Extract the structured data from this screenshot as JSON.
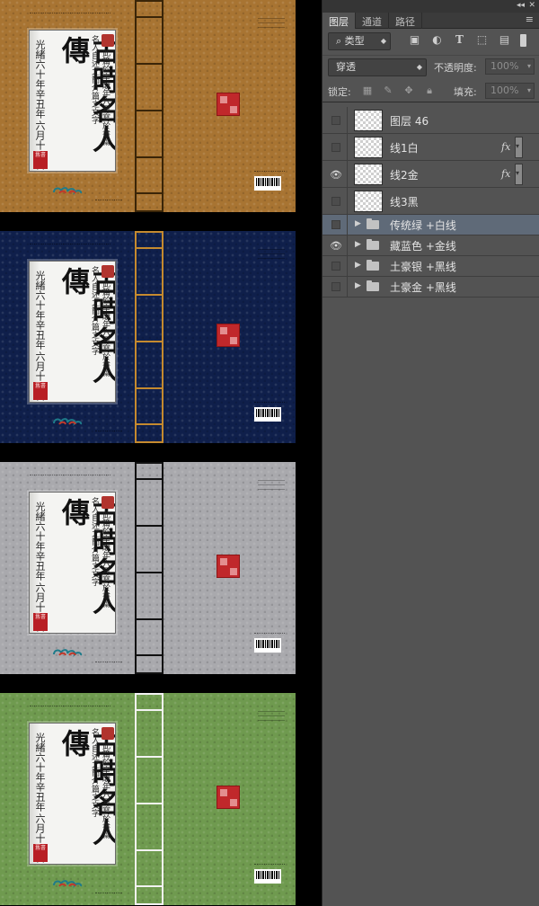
{
  "covers": [
    {
      "id": "brown",
      "bg": "#a87432",
      "spine_line": "#3a2508",
      "title": "古時名人傳",
      "date": "光緒六十年辛丑年",
      "date2": "六月十八日",
      "desc1": "名人自述之簡介篇之文字",
      "desc2": "此篇於辛醜年六月寫於書齋",
      "seal_text": "舊書"
    },
    {
      "id": "navy",
      "bg": "#0f1f4b",
      "spine_line": "#c58a2f",
      "title": "古時名人傳",
      "date": "光緒六十年辛丑年",
      "date2": "六月十八日",
      "desc1": "名人自述之簡介篇之文字",
      "desc2": "此篇於辛醜年六月寫於書齋",
      "seal_text": "舊書"
    },
    {
      "id": "silver",
      "bg": "#a9a9ad",
      "spine_line": "#111111",
      "title": "古時名人傳",
      "date": "光緒六十年辛丑年",
      "date2": "六月十八日",
      "desc1": "名人自述之簡介篇之文字",
      "desc2": "此篇於辛醜年六月寫於書齋",
      "seal_text": "舊書"
    },
    {
      "id": "green",
      "bg": "#6f9a4f",
      "spine_line": "#f2f2f2",
      "title": "古時名人傳",
      "date": "光緒六十年辛丑年",
      "date2": "六月十八日",
      "desc1": "名人自述之簡介篇之文字",
      "desc2": "此篇於辛醜年六月寫於書齋",
      "seal_text": "舊書"
    }
  ],
  "panel": {
    "top_icons": {
      "collapse": "◂◂",
      "close": "✕"
    },
    "tabs": [
      {
        "label": "图层",
        "active": true
      },
      {
        "label": "通道",
        "active": false
      },
      {
        "label": "路径",
        "active": false
      }
    ],
    "menu_icon": "≡",
    "filter": {
      "kind_label": "类型",
      "search_icon": "⌕",
      "icons": [
        "image-filter-icon",
        "adjustment-filter-icon",
        "type-filter-icon",
        "shape-filter-icon",
        "smart-object-filter-icon"
      ]
    },
    "blend": {
      "mode": "穿透",
      "opacity_label": "不透明度:",
      "opacity_value": "100%"
    },
    "lock": {
      "label": "锁定:",
      "fill_label": "填充:",
      "fill_value": "100%"
    },
    "layers": [
      {
        "name": "图层 46",
        "visible": false,
        "type": "pixel",
        "fx": false
      },
      {
        "name": "线1白",
        "visible": false,
        "type": "pixel",
        "fx": true
      },
      {
        "name": "线2金",
        "visible": true,
        "type": "pixel",
        "fx": true
      },
      {
        "name": "线3黑",
        "visible": false,
        "type": "pixel",
        "fx": false
      },
      {
        "name": "传统绿 +白线",
        "visible": false,
        "type": "group",
        "selected": true
      },
      {
        "name": "藏蓝色 +金线",
        "visible": true,
        "type": "group"
      },
      {
        "name": "土豪银 +黑线",
        "visible": false,
        "type": "group"
      },
      {
        "name": "土豪金 +黑线",
        "visible": false,
        "type": "group"
      }
    ],
    "fx_label": "fx"
  }
}
